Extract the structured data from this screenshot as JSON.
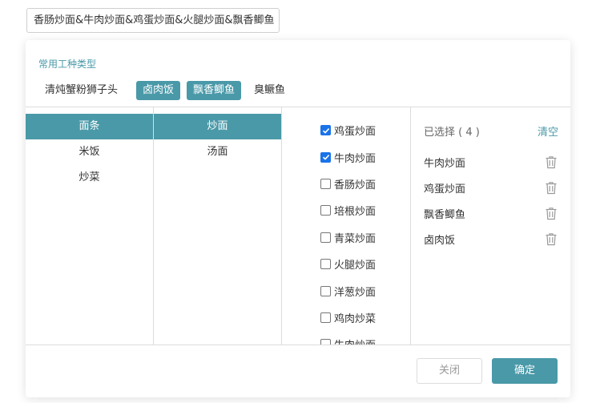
{
  "input": {
    "value": "香肠炒面&牛肉炒面&鸡蛋炒面&火腿炒面&飘香鲫鱼"
  },
  "common": {
    "title": "常用工种类型",
    "tags": [
      {
        "label": "清炖蟹粉狮子头",
        "active": false
      },
      {
        "label": "卤肉饭",
        "active": true
      },
      {
        "label": "飘香鲫鱼",
        "active": true
      },
      {
        "label": "臭鳜鱼",
        "active": false
      }
    ]
  },
  "categories": [
    {
      "label": "面条",
      "active": true
    },
    {
      "label": "米饭",
      "active": false
    },
    {
      "label": "炒菜",
      "active": false
    }
  ],
  "subcategories": [
    {
      "label": "炒面",
      "active": true
    },
    {
      "label": "汤面",
      "active": false
    }
  ],
  "dishes": [
    {
      "label": "鸡蛋炒面",
      "checked": true
    },
    {
      "label": "牛肉炒面",
      "checked": true
    },
    {
      "label": "香肠炒面",
      "checked": false
    },
    {
      "label": "培根炒面",
      "checked": false
    },
    {
      "label": "青菜炒面",
      "checked": false
    },
    {
      "label": "火腿炒面",
      "checked": false
    },
    {
      "label": "洋葱炒面",
      "checked": false
    },
    {
      "label": "鸡肉炒菜",
      "checked": false
    },
    {
      "label": "牛肉炒面",
      "checked": false
    }
  ],
  "selected": {
    "title": "已选择 ( 4 )",
    "clear_label": "清空",
    "items": [
      "牛肉炒面",
      "鸡蛋炒面",
      "飘香鲫鱼",
      "卤肉饭"
    ],
    "item_icon": "trash-icon"
  },
  "footer": {
    "close_label": "关闭",
    "ok_label": "确定"
  },
  "colors": {
    "accent": "#4a99a8",
    "checkbox": "#1a73e8"
  }
}
